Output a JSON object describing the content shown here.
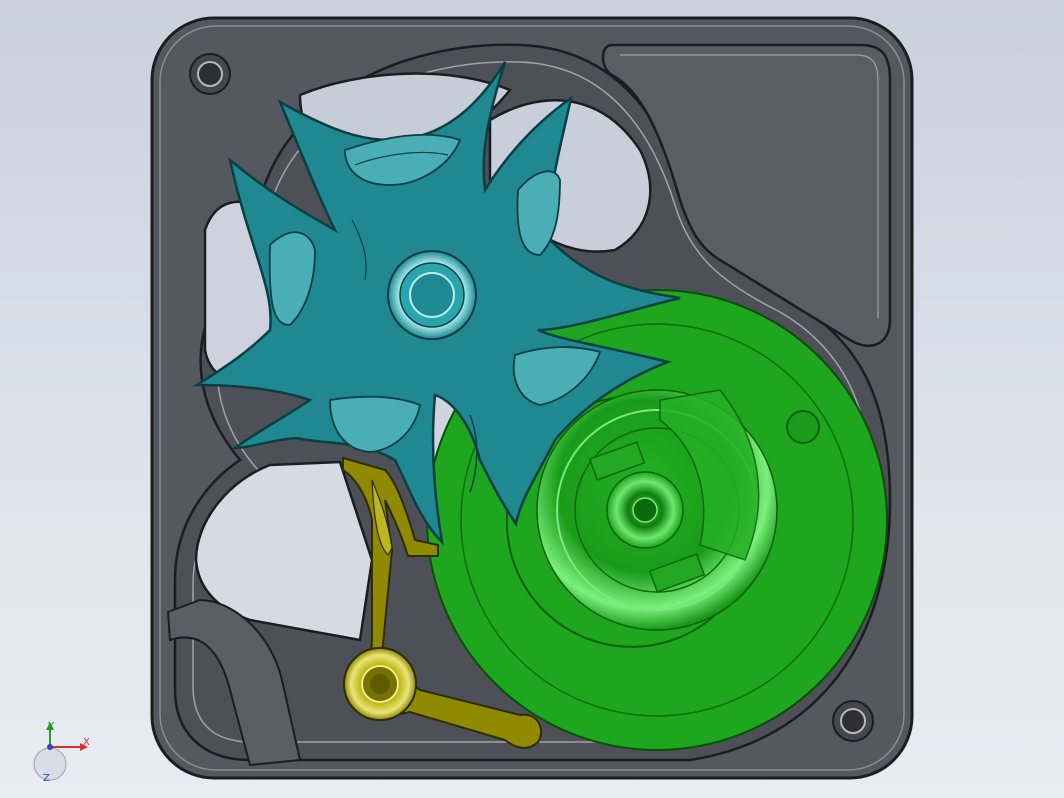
{
  "viewport": {
    "background_top": "#c9d0dd",
    "background_bottom": "#e9edf2"
  },
  "model": {
    "parts": [
      {
        "name": "housing-plate",
        "color": "#55585e"
      },
      {
        "name": "star-wheel",
        "color": "#1f8890"
      },
      {
        "name": "disc-cam",
        "color": "#1ea61e"
      },
      {
        "name": "pawl-lever",
        "color": "#8f8a00"
      }
    ]
  },
  "triad": {
    "x_label": "X",
    "y_label": "Y",
    "z_label": "Z",
    "x_color": "#d33333",
    "y_color": "#2a9a2a",
    "z_color": "#3344bb"
  }
}
